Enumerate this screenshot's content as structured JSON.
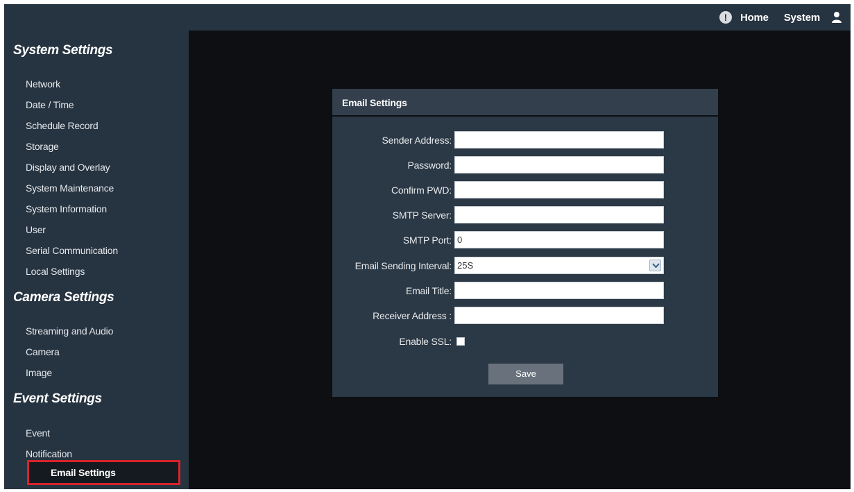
{
  "topbar": {
    "home_label": "Home",
    "system_label": "System",
    "alert_icon": "alert-icon",
    "user_icon": "user-icon"
  },
  "sidebar": {
    "sections": [
      {
        "title": "System Settings",
        "items": [
          "Network",
          "Date / Time",
          "Schedule Record",
          "Storage",
          "Display and Overlay",
          "System Maintenance",
          "System Information",
          "User",
          "Serial Communication",
          "Local Settings"
        ]
      },
      {
        "title": "Camera Settings",
        "items": [
          "Streaming and Audio",
          "Camera",
          "Image"
        ]
      },
      {
        "title": "Event Settings",
        "items": [
          "Event",
          "Notification"
        ]
      }
    ],
    "active_item": "Email Settings"
  },
  "panel": {
    "title": "Email Settings",
    "fields": [
      {
        "label": "Sender Address:",
        "value": ""
      },
      {
        "label": "Password:",
        "value": ""
      },
      {
        "label": "Confirm PWD:",
        "value": ""
      },
      {
        "label": "SMTP Server:",
        "value": ""
      },
      {
        "label": "SMTP Port:",
        "value": "0"
      },
      {
        "label": "Email Sending Interval:",
        "value": "25S"
      },
      {
        "label": "Email Title:",
        "value": ""
      },
      {
        "label": "Receiver Address :",
        "value": ""
      }
    ],
    "ssl_label": "Enable SSL:",
    "save_label": "Save"
  },
  "colors": {
    "bar": "#263340",
    "panel": "#2b3845",
    "background": "#0d0f12",
    "highlight": "#d8232a"
  }
}
